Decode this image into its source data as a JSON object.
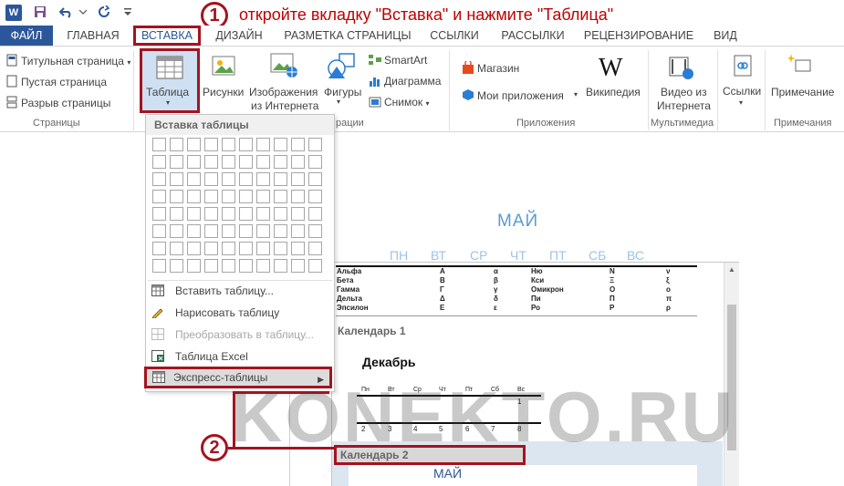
{
  "titlebar": {
    "logo_letter": "W",
    "annotation1_number": "1",
    "annotation1_text": "откройте вкладку \"Вставка\" и нажмите \"Таблица\""
  },
  "tabs": [
    {
      "label": "ФАЙЛ"
    },
    {
      "label": "ГЛАВНАЯ"
    },
    {
      "label": "ВСТАВКА"
    },
    {
      "label": "ДИЗАЙН"
    },
    {
      "label": "РАЗМЕТКА СТРАНИЦЫ"
    },
    {
      "label": "ССЫЛКИ"
    },
    {
      "label": "РАССЫЛКИ"
    },
    {
      "label": "РЕЦЕНЗИРОВАНИЕ"
    },
    {
      "label": "ВИД"
    }
  ],
  "ribbon": {
    "pages": {
      "cover": "Титульная страница",
      "blank": "Пустая страница",
      "break": "Разрыв страницы",
      "group": "Страницы"
    },
    "table": {
      "label": "Таблица"
    },
    "illustrations": {
      "pictures": "Рисунки",
      "online1": "Изображения",
      "online2": "из Интернета",
      "shapes": "Фигуры",
      "smartart": "SmartArt",
      "chart": "Диаграмма",
      "screenshot": "Снимок",
      "group_partial": "рации"
    },
    "apps": {
      "store": "Магазин",
      "myapps": "Мои приложения",
      "wikipedia": "Википедия",
      "group": "Приложения"
    },
    "media": {
      "video1": "Видео из",
      "video2": "Интернета",
      "group": "Мультимедиа"
    },
    "links": {
      "label": "Ссылки"
    },
    "comments": {
      "label": "Примечание",
      "group": "Примечания"
    }
  },
  "table_menu": {
    "header": "Вставка таблицы",
    "grid_cols": 10,
    "grid_rows": 8,
    "items": [
      {
        "label": "Вставить таблицу...",
        "enabled": true
      },
      {
        "label": "Нарисовать таблицу",
        "enabled": true
      },
      {
        "label": "Преобразовать в таблицу...",
        "enabled": false
      },
      {
        "label": "Таблица Excel",
        "enabled": true
      },
      {
        "label": "Экспресс-таблицы",
        "enabled": true
      }
    ]
  },
  "document": {
    "month": "МАЙ",
    "weekdays": [
      "ПН",
      "ВТ",
      "СР",
      "ЧТ",
      "ПТ",
      "СБ",
      "ВС"
    ]
  },
  "gallery": {
    "greek_rows": [
      [
        "Альфа",
        "Α",
        "α",
        "Ню",
        "Ν",
        "ν"
      ],
      [
        "Бета",
        "Β",
        "β",
        "Кси",
        "Ξ",
        "ξ"
      ],
      [
        "Гамма",
        "Γ",
        "γ",
        "Омикрон",
        "Ο",
        "ο"
      ],
      [
        "Дельта",
        "Δ",
        "δ",
        "Пи",
        "Π",
        "π"
      ],
      [
        "Эпсилон",
        "Ε",
        "ε",
        "Ро",
        "Ρ",
        "ρ"
      ]
    ],
    "calendar1": {
      "title": "Календарь 1",
      "month": "Декабрь",
      "days": [
        "Пн",
        "Вт",
        "Ср",
        "Чт",
        "Пт",
        "Сб",
        "Вс"
      ],
      "first_row": [
        "",
        "",
        "",
        "",
        "",
        "",
        "1"
      ],
      "second_row": [
        "2",
        "3",
        "4",
        "5",
        "6",
        "7",
        "8"
      ]
    },
    "calendar2": {
      "title": "Календарь 2",
      "month": "МАЙ"
    }
  },
  "annotation2_number": "2",
  "watermark": "KONEKTO.RU"
}
